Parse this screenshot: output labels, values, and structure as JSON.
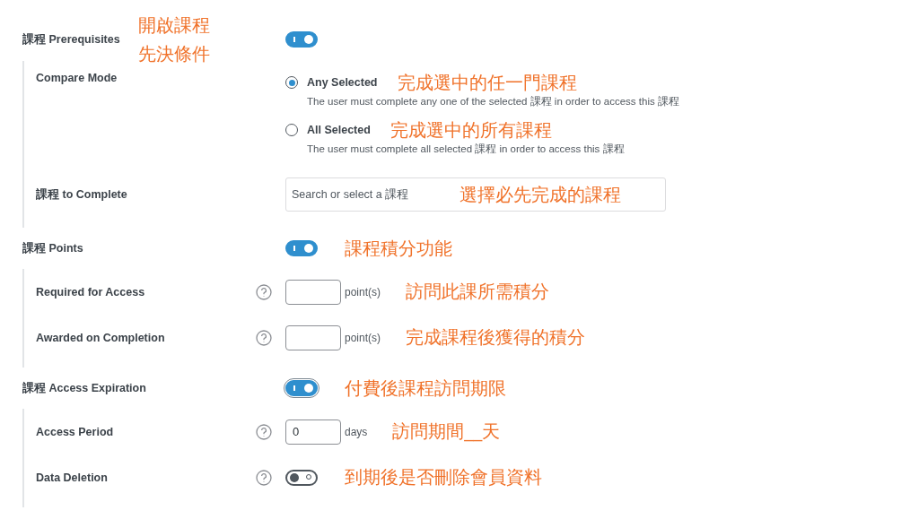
{
  "sections": [
    {
      "label": "課程 Prerequisites",
      "note": "開啟課程先決條件",
      "toggle": {
        "on": true,
        "focused": false
      },
      "fields": [
        {
          "kind": "radio",
          "label": "Compare Mode",
          "options": [
            {
              "label": "Any Selected",
              "selected": true,
              "note": "完成選中的任一門課程",
              "description": "The user must complete any one of the selected 課程 in order to access this 課程"
            },
            {
              "label": "All Selected",
              "selected": false,
              "note": "完成選中的所有課程",
              "description": "The user must complete all selected 課程 in order to access this 課程"
            }
          ]
        },
        {
          "kind": "search",
          "label": "課程 to Complete",
          "placeholder": "Search or select a 課程",
          "note": "選擇必先完成的課程"
        }
      ]
    },
    {
      "label": "課程 Points",
      "note": "課程積分功能",
      "toggle": {
        "on": true,
        "focused": false
      },
      "fields": [
        {
          "kind": "number",
          "label": "Required for Access",
          "unit": "point(s)",
          "note": "訪問此課所需積分"
        },
        {
          "kind": "number",
          "label": "Awarded on Completion",
          "unit": "point(s)",
          "note": "完成課程後獲得的積分"
        }
      ]
    },
    {
      "label": "課程 Access Expiration",
      "note": "付費後課程訪問期限",
      "toggle": {
        "on": true,
        "focused": true
      },
      "fields": [
        {
          "kind": "number",
          "label": "Access Period",
          "value": "0",
          "unit": "days",
          "note": "訪問期間__天"
        },
        {
          "kind": "toggle",
          "label": "Data Deletion",
          "toggle": {
            "on": false,
            "focused": false
          },
          "note": "到期後是否刪除會員資料"
        }
      ]
    }
  ]
}
